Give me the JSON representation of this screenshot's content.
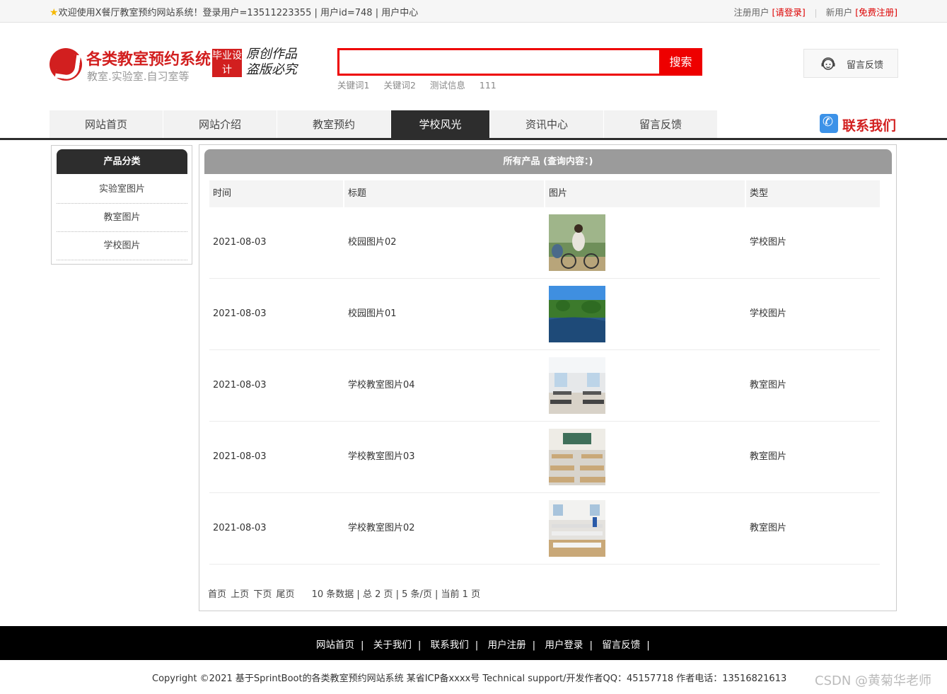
{
  "topbar": {
    "welcome": "欢迎使用X餐厅教室预约网站系统！登录用户=13511223355 | 用户id=748 | 用户中心",
    "registered_label": "注册用户",
    "login_link": "[请登录]",
    "new_user_label": "新用户",
    "register_link": "[免费注册]"
  },
  "logo": {
    "title": "各类教室预约系统",
    "subtitle": "教室.实验室.自习室等",
    "badge": "毕业设计",
    "slogan": "原创作品 盗版必究"
  },
  "search": {
    "placeholder": "",
    "button_label": "搜索",
    "keywords": [
      "关键词1",
      "关键词2",
      "测试信息",
      "111"
    ]
  },
  "feedback_button": "留言反馈",
  "nav": {
    "items": [
      "网站首页",
      "网站介绍",
      "教室预约",
      "学校风光",
      "资讯中心",
      "留言反馈"
    ],
    "active": "学校风光",
    "contact": "联系我们"
  },
  "sidebar": {
    "title": "产品分类",
    "categories": [
      "实验室图片",
      "教室图片",
      "学校图片"
    ]
  },
  "main": {
    "title": "所有产品 (查询内容：)",
    "columns": [
      "时间",
      "标题",
      "图片",
      "类型"
    ],
    "rows": [
      {
        "date": "2021-08-03",
        "title": "校园图片02",
        "type": "学校图片"
      },
      {
        "date": "2021-08-03",
        "title": "校园图片01",
        "type": "学校图片"
      },
      {
        "date": "2021-08-03",
        "title": "学校教室图片04",
        "type": "教室图片"
      },
      {
        "date": "2021-08-03",
        "title": "学校教室图片03",
        "type": "教室图片"
      },
      {
        "date": "2021-08-03",
        "title": "学校教室图片02",
        "type": "教室图片"
      }
    ],
    "pager": {
      "first": "首页",
      "prev": "上页",
      "next": "下页",
      "last": "尾页",
      "summary": "10 条数据 | 总 2 页 | 5 条/页 | 当前 1 页"
    }
  },
  "footer": {
    "links": [
      "网站首页",
      "关于我们",
      "联系我们",
      "用户注册",
      "用户登录",
      "留言反馈"
    ],
    "copyright": "Copyright ©2021 基于SprintBoot的各类教室预约网站系统   某省ICP备xxxx号   Technical support/开发作者QQ：45157718    作者电话：13516821613"
  },
  "watermark": "CSDN @黄菊华老师",
  "colors": {
    "accent": "#e00000",
    "dark": "#2d2d2d",
    "header_gray": "#9b9b9b"
  }
}
